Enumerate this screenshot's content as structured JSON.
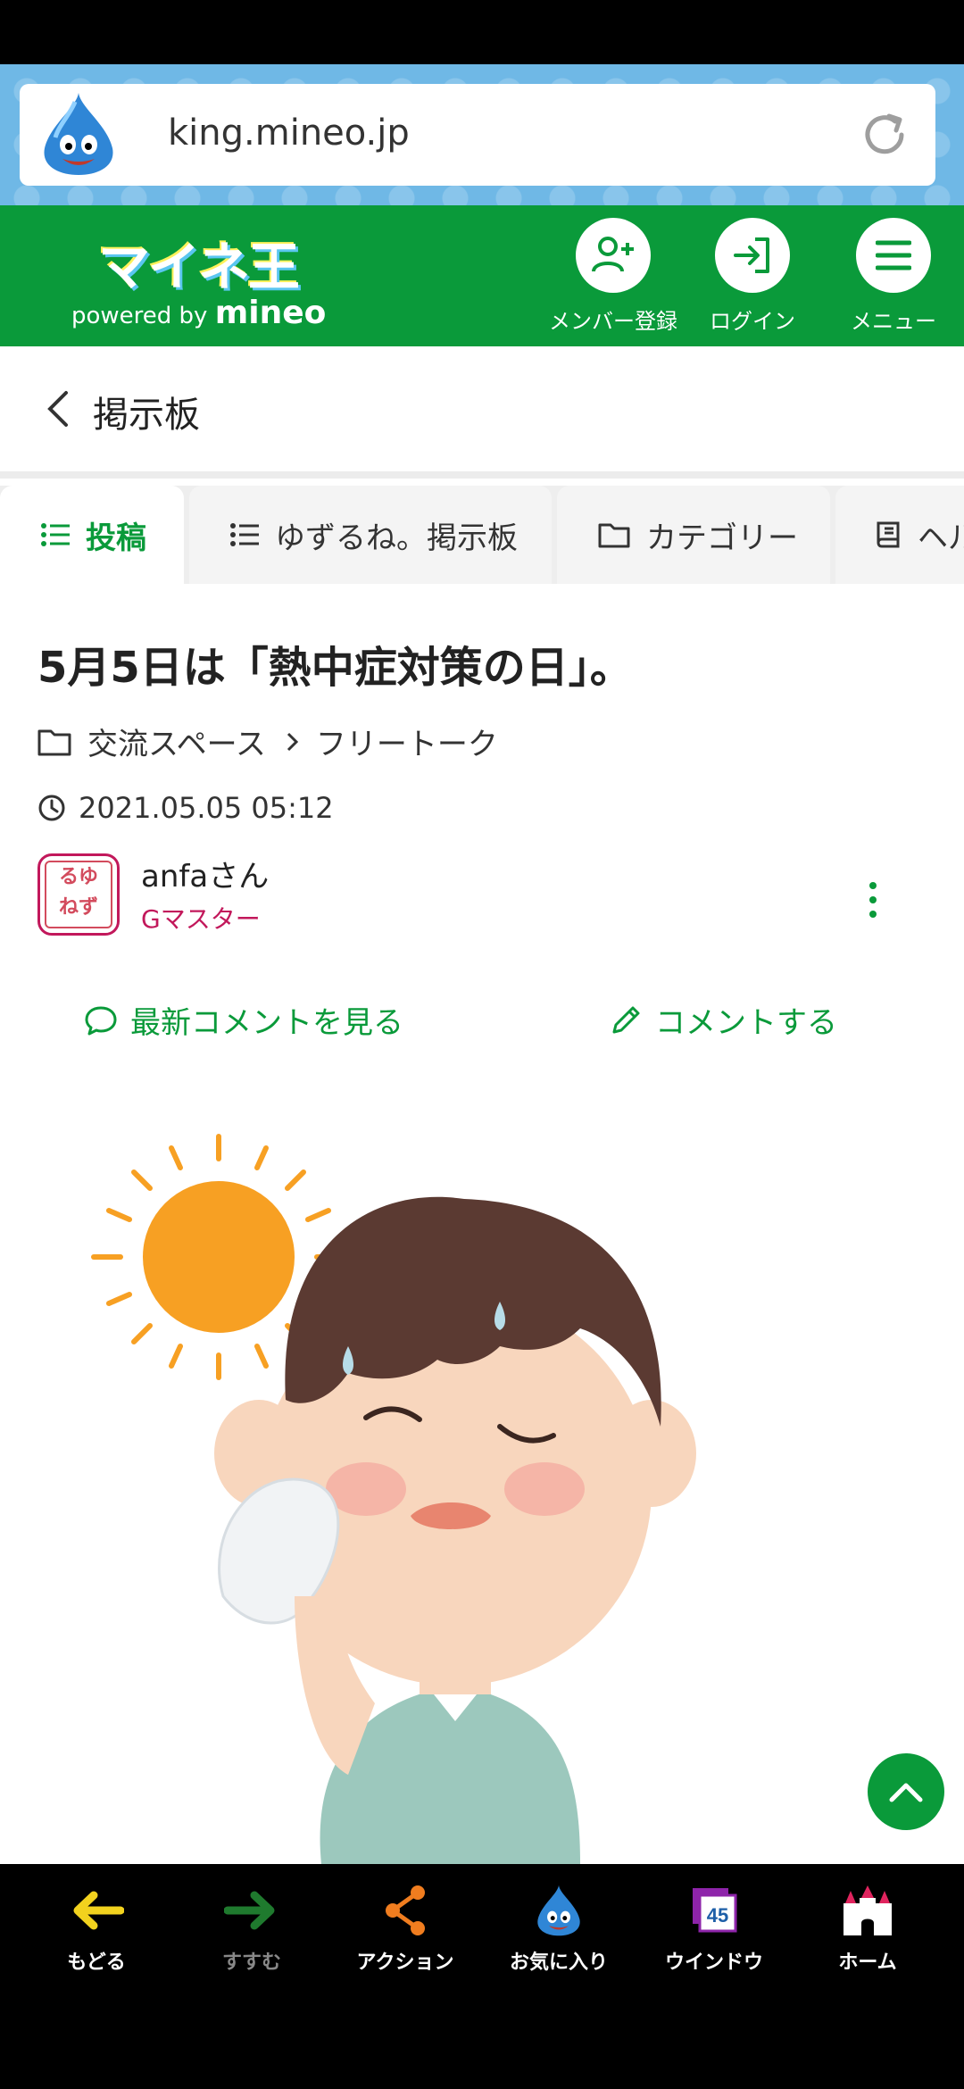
{
  "browser": {
    "url": "king.mineo.jp"
  },
  "site_header": {
    "logo_text": "マイネ王",
    "logo_sub_prefix": "powered by",
    "logo_sub_brand": "mineo",
    "buttons": [
      {
        "label": "メンバー登録",
        "icon": "add-user-icon"
      },
      {
        "label": "ログイン",
        "icon": "login-icon"
      },
      {
        "label": "メニュー",
        "icon": "menu-icon"
      }
    ]
  },
  "breadcrumb": {
    "title": "掲示板"
  },
  "tabs": [
    {
      "label": "投稿",
      "active": true,
      "icon": "list-icon"
    },
    {
      "label": "ゆずるね。掲示板",
      "active": false,
      "icon": "list-icon"
    },
    {
      "label": "カテゴリー",
      "active": false,
      "icon": "folder-icon"
    },
    {
      "label": "ヘル",
      "active": false,
      "icon": "book-icon"
    }
  ],
  "post": {
    "title": "5月5日は「熱中症対策の日」。",
    "category": "交流スペース",
    "subcategory": "フリートーク",
    "date": "2021.05.05 05:12",
    "author": {
      "name": "anfaさん",
      "rank": "Gマスター",
      "avatar_text_top": "るゆ",
      "avatar_text_bottom": "ねず"
    },
    "actions": {
      "view_comments": "最新コメントを見る",
      "comment": "コメントする"
    }
  },
  "bottom_bar": [
    {
      "label": "もどる",
      "icon": "back-arrow-icon",
      "enabled": true
    },
    {
      "label": "すすむ",
      "icon": "forward-arrow-icon",
      "enabled": false
    },
    {
      "label": "アクション",
      "icon": "share-icon",
      "enabled": true
    },
    {
      "label": "お気に入り",
      "icon": "slime-icon",
      "enabled": true
    },
    {
      "label": "ウインドウ",
      "icon": "window-icon",
      "enabled": true,
      "badge": "45"
    },
    {
      "label": "ホーム",
      "icon": "castle-icon",
      "enabled": true
    }
  ],
  "colors": {
    "brand_green": "#0a9a3a",
    "rank_magenta": "#c2185b",
    "browser_blue": "#6fb8e6"
  }
}
